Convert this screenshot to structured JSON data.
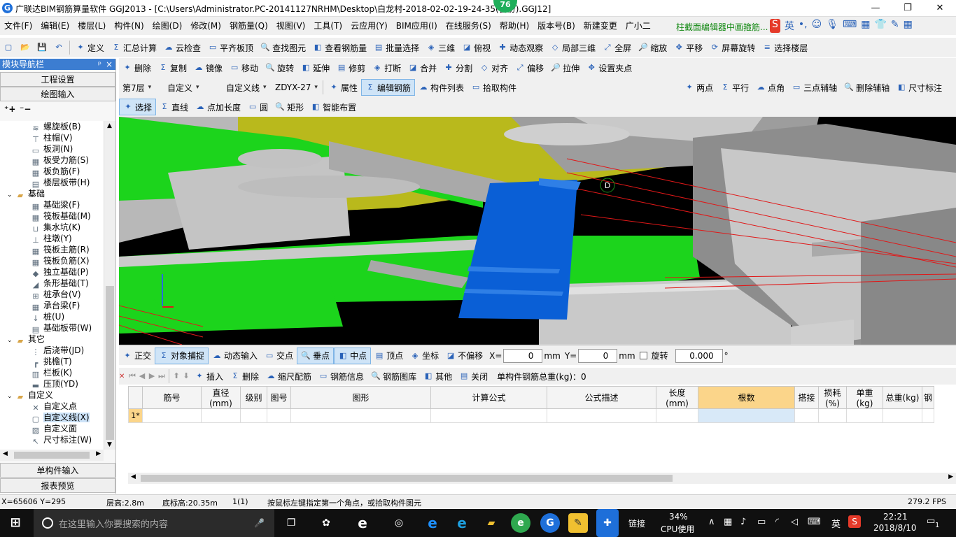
{
  "titlebar": {
    "title": "广联达BIM钢筋算量软件 GGJ2013 - [C:\\Users\\Administrator.PC-20141127NRHM\\Desktop\\白龙村-2018-02-02-19-24-35(备份).GGJ12]",
    "badge": "76",
    "min": "—",
    "restore": "❐",
    "close": "✕"
  },
  "menu": {
    "items": [
      "文件(F)",
      "编辑(E)",
      "楼层(L)",
      "构件(N)",
      "绘图(D)",
      "修改(M)",
      "钢筋量(Q)",
      "视图(V)",
      "工具(T)",
      "云应用(Y)",
      "BIM应用(I)",
      "在线服务(S)",
      "帮助(H)",
      "版本号(B)",
      "新建变更",
      "广小二"
    ],
    "hint": "柱截面编辑器中画箍筋..."
  },
  "tb1": {
    "items": [
      "定义",
      "汇总计算",
      "云检查",
      "平齐板顶",
      "查找图元",
      "查看钢筋量",
      "批量选择",
      "三维",
      "俯视",
      "动态观察",
      "局部三维",
      "全屏",
      "缩放",
      "平移",
      "屏幕旋转",
      "选择楼层"
    ]
  },
  "tb2": {
    "items": [
      "删除",
      "复制",
      "镜像",
      "移动",
      "旋转",
      "延伸",
      "修剪",
      "打断",
      "合并",
      "分割",
      "对齐",
      "偏移",
      "拉伸",
      "设置夹点"
    ]
  },
  "tb3": {
    "floor": "第7层",
    "type": "自定义",
    "subtype": "自定义线",
    "name": "ZDYX-27",
    "items": [
      "属性",
      "编辑钢筋",
      "构件列表",
      "拾取构件"
    ],
    "axis_items": [
      "两点",
      "平行",
      "点角",
      "三点辅轴",
      "删除辅轴",
      "尺寸标注"
    ]
  },
  "tb4": {
    "items": [
      "选择",
      "直线",
      "点加长度",
      "圆",
      "矩形",
      "智能布置"
    ]
  },
  "nav": {
    "title": "模块导航栏",
    "pin": "ᵖ",
    "close": "×",
    "btn_setup": "工程设置",
    "btn_draw": "绘图输入",
    "btn_single": "单构件输入",
    "btn_report": "报表预览",
    "tree": [
      {
        "label": "螺旋板(B)",
        "level": 2,
        "icon": "≋"
      },
      {
        "label": "柱帽(V)",
        "level": 2,
        "icon": "⊤"
      },
      {
        "label": "板洞(N)",
        "level": 2,
        "icon": "▭"
      },
      {
        "label": "板受力筋(S)",
        "level": 2,
        "icon": "▦"
      },
      {
        "label": "板负筋(F)",
        "level": 2,
        "icon": "▦"
      },
      {
        "label": "楼层板带(H)",
        "level": 2,
        "icon": "▤"
      },
      {
        "label": "基础",
        "level": 1,
        "icon": "▰"
      },
      {
        "label": "基础梁(F)",
        "level": 2,
        "icon": "▦"
      },
      {
        "label": "筏板基础(M)",
        "level": 2,
        "icon": "▦"
      },
      {
        "label": "集水坑(K)",
        "level": 2,
        "icon": "⊔"
      },
      {
        "label": "柱墩(Y)",
        "level": 2,
        "icon": "⊥"
      },
      {
        "label": "筏板主筋(R)",
        "level": 2,
        "icon": "▦"
      },
      {
        "label": "筏板负筋(X)",
        "level": 2,
        "icon": "▦"
      },
      {
        "label": "独立基础(P)",
        "level": 2,
        "icon": "◆"
      },
      {
        "label": "条形基础(T)",
        "level": 2,
        "icon": "◢"
      },
      {
        "label": "桩承台(V)",
        "level": 2,
        "icon": "⊞"
      },
      {
        "label": "承台梁(F)",
        "level": 2,
        "icon": "▦"
      },
      {
        "label": "桩(U)",
        "level": 2,
        "icon": "↓"
      },
      {
        "label": "基础板带(W)",
        "level": 2,
        "icon": "▤"
      },
      {
        "label": "其它",
        "level": 1,
        "icon": "▰"
      },
      {
        "label": "后浇带(JD)",
        "level": 2,
        "icon": "⋮"
      },
      {
        "label": "挑檐(T)",
        "level": 2,
        "icon": "┏"
      },
      {
        "label": "栏板(K)",
        "level": 2,
        "icon": "▥"
      },
      {
        "label": "压顶(YD)",
        "level": 2,
        "icon": "▬"
      },
      {
        "label": "自定义",
        "level": 1,
        "icon": "▰"
      },
      {
        "label": "自定义点",
        "level": 2,
        "icon": "✕"
      },
      {
        "label": "自定义线(X)",
        "level": 2,
        "icon": "▢",
        "selected": true
      },
      {
        "label": "自定义面",
        "level": 2,
        "icon": "▨"
      },
      {
        "label": "尺寸标注(W)",
        "level": 2,
        "icon": "↖"
      }
    ]
  },
  "snapbar": {
    "items": [
      "正交",
      "对象捕捉",
      "动态输入",
      "交点",
      "垂点",
      "中点",
      "顶点",
      "坐标",
      "不偏移"
    ],
    "xlabel": "X=",
    "xval": "0",
    "unit": "mm",
    "ylabel": "Y=",
    "yval": "0",
    "rotate": "旋转",
    "angle": "0.000",
    "deg": "°"
  },
  "gridtool": {
    "items": [
      "插入",
      "删除",
      "缩尺配筋",
      "钢筋信息",
      "钢筋图库",
      "其他",
      "关闭"
    ],
    "total_label": "单构件钢筋总重(kg)：0"
  },
  "grid": {
    "headers": [
      "筋号",
      "直径(mm)",
      "级别",
      "图号",
      "图形",
      "计算公式",
      "公式描述",
      "长度(mm)",
      "根数",
      "搭接",
      "损耗(%)",
      "单重(kg)",
      "总重(kg)",
      "钢"
    ],
    "rows": [
      {
        "num": "1*"
      }
    ]
  },
  "viewport": {
    "marker": "D"
  },
  "status": {
    "coords": "X=65606 Y=295",
    "floor_h": "层高:2.8m",
    "base_h": "底标高:20.35m",
    "count": "1(1)",
    "hint": "按鼠标左键指定第一个角点，或拾取构件图元",
    "fps": "279.2 FPS"
  },
  "taskbar": {
    "search": "在这里输入你要搜索的内容",
    "link": "链接",
    "cpu_pct": "34%",
    "cpu_label": "CPU使用",
    "ime": "英",
    "time": "22:21",
    "date": "2018/8/10",
    "notif": "1"
  },
  "colors": {
    "accent": "#3c7dd1",
    "selected_blue": "#0a5fd6",
    "green": "#1bd41b",
    "olive": "#b6b61a",
    "gray": "#c7c7c7"
  }
}
